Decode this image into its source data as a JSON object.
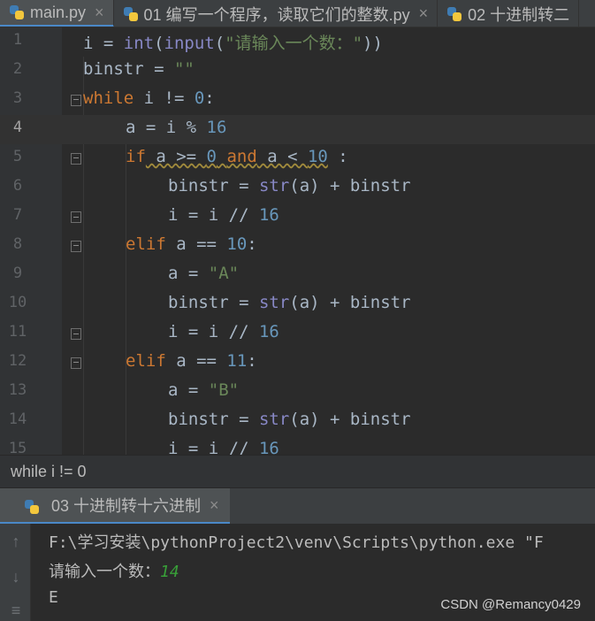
{
  "tabs": [
    {
      "label": "main.py",
      "active": true
    },
    {
      "label": "01 编写一个程序，读取它们的整数.py",
      "active": false
    },
    {
      "label": "02 十进制转二",
      "active": false
    }
  ],
  "editor": {
    "current_line": 4,
    "line_numbers": [
      "1",
      "2",
      "3",
      "4",
      "5",
      "6",
      "7",
      "8",
      "9",
      "10",
      "11",
      "12",
      "13",
      "14",
      "15"
    ],
    "lines": {
      "l1": {
        "a": "i = ",
        "b": "int",
        "c": "(",
        "d": "input",
        "e": "(",
        "f": "\"请输入一个数：\"",
        "g": "))"
      },
      "l2": {
        "a": "binstr = ",
        "b": "\"\""
      },
      "l3": {
        "a": "while",
        "b": " i != ",
        "c": "0",
        "d": ":"
      },
      "l4": {
        "a": "a = i % ",
        "b": "16"
      },
      "l5": {
        "a": "if",
        "b": " a >= ",
        "c": "0",
        "d": " ",
        "e": "and",
        "f": " a < ",
        "g": "10",
        "h": " :"
      },
      "l6": {
        "a": "binstr = ",
        "b": "str",
        "c": "(a) + binstr"
      },
      "l7": {
        "a": "i = i // ",
        "b": "16"
      },
      "l8": {
        "a": "elif",
        "b": " a == ",
        "c": "10",
        "d": ":"
      },
      "l9": {
        "a": "a = ",
        "b": "\"A\""
      },
      "l10": {
        "a": "binstr = ",
        "b": "str",
        "c": "(a) + binstr"
      },
      "l11": {
        "a": "i = i // ",
        "b": "16"
      },
      "l12": {
        "a": "elif",
        "b": " a == ",
        "c": "11",
        "d": ":"
      },
      "l13": {
        "a": "a = ",
        "b": "\"B\""
      },
      "l14": {
        "a": "binstr = ",
        "b": "str",
        "c": "(a) + binstr"
      },
      "l15": {
        "a": "i = i // ",
        "b": "16"
      }
    }
  },
  "breadcrumb": "while i != 0",
  "run_panel": {
    "tab_label": "03 十进制转十六进制",
    "console": {
      "command": "F:\\学习安装\\pythonProject2\\venv\\Scripts\\python.exe \"F",
      "prompt": "请输入一个数：",
      "user_input": "14",
      "output": "E"
    }
  },
  "watermark": "CSDN @Remancy0429",
  "colors": {
    "keyword": "#cc7832",
    "number": "#6897bb",
    "string": "#6a8759",
    "builtin": "#8888c6",
    "console_input": "#389f38"
  }
}
